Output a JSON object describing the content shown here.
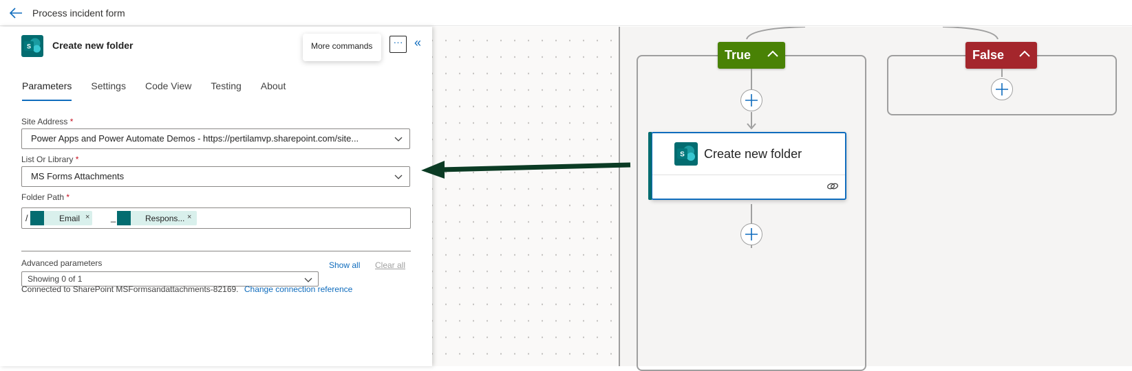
{
  "header": {
    "title": "Process incident form"
  },
  "panel": {
    "action_title": "Create new folder",
    "tooltip": "More commands",
    "more_glyph": "···",
    "collapse_glyph": "«",
    "tabs": [
      {
        "label": "Parameters",
        "active": true
      },
      {
        "label": "Settings",
        "active": false
      },
      {
        "label": "Code View",
        "active": false
      },
      {
        "label": "Testing",
        "active": false
      },
      {
        "label": "About",
        "active": false
      }
    ],
    "fields": {
      "site_address": {
        "label": "Site Address",
        "required": "*",
        "value": "Power Apps and Power Automate Demos - https://pertilamvp.sharepoint.com/site..."
      },
      "list_or_library": {
        "label": "List Or Library",
        "required": "*",
        "value": "MS Forms Attachments"
      },
      "folder_path": {
        "label": "Folder Path",
        "required": "*",
        "prefix": "/",
        "separator": "_",
        "tokens": [
          {
            "label": "Email",
            "remove": "×"
          },
          {
            "label": "Respons...",
            "remove": "×"
          }
        ]
      }
    },
    "advanced": {
      "label": "Advanced parameters",
      "select_value": "Showing 0 of 1",
      "show_all": "Show all",
      "clear_all": "Clear all"
    },
    "connection": {
      "text": "Connected to SharePoint MSFormsandattachments-82169.",
      "change_link": "Change connection reference"
    }
  },
  "canvas": {
    "true_label": "True",
    "false_label": "False",
    "card_title": "Create new folder",
    "colors": {
      "true": "#498205",
      "false": "#a4262c",
      "sharepoint": "#036c70",
      "accent": "#0f6cbd",
      "arrow": "#0b3b24"
    }
  }
}
